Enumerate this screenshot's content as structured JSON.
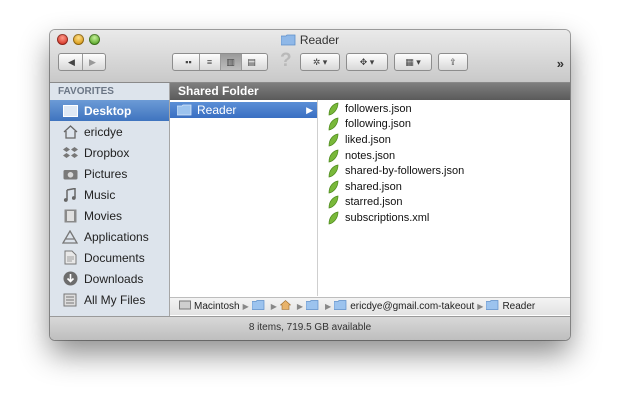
{
  "window": {
    "title": "Reader"
  },
  "toolbar": {
    "back_icon": "back-arrow-icon",
    "forward_icon": "forward-arrow-icon",
    "view_modes": [
      "icon-view",
      "list-view",
      "column-view",
      "cover-flow-view"
    ],
    "active_view": "column-view",
    "overflow_label": "»"
  },
  "sidebar": {
    "heading": "FAVORITES",
    "items": [
      {
        "label": "Desktop",
        "icon": "desktop-icon",
        "selected": true
      },
      {
        "label": "ericdye",
        "icon": "home-icon",
        "selected": false
      },
      {
        "label": "Dropbox",
        "icon": "dropbox-icon",
        "selected": false
      },
      {
        "label": "Pictures",
        "icon": "camera-icon",
        "selected": false
      },
      {
        "label": "Music",
        "icon": "music-note-icon",
        "selected": false
      },
      {
        "label": "Movies",
        "icon": "film-icon",
        "selected": false
      },
      {
        "label": "Applications",
        "icon": "applications-icon",
        "selected": false
      },
      {
        "label": "Documents",
        "icon": "documents-icon",
        "selected": false
      },
      {
        "label": "Downloads",
        "icon": "download-icon",
        "selected": false
      },
      {
        "label": "All My Files",
        "icon": "all-files-icon",
        "selected": false
      }
    ]
  },
  "header": {
    "title": "Shared Folder"
  },
  "column1": {
    "selected_item": "Reader"
  },
  "column2": {
    "files": [
      "followers.json",
      "following.json",
      "liked.json",
      "notes.json",
      "shared-by-followers.json",
      "shared.json",
      "starred.json",
      "subscriptions.xml"
    ]
  },
  "pathbar": {
    "segments": [
      "Macintosh",
      "",
      "",
      "",
      "ericdye@gmail.com-takeout",
      "Reader"
    ]
  },
  "status": {
    "text": "8 items, 719.5 GB available"
  },
  "colors": {
    "selection": "#3f74bf",
    "sidebar_bg": "#dde4ec",
    "header_strip": "#6b6b6b"
  }
}
